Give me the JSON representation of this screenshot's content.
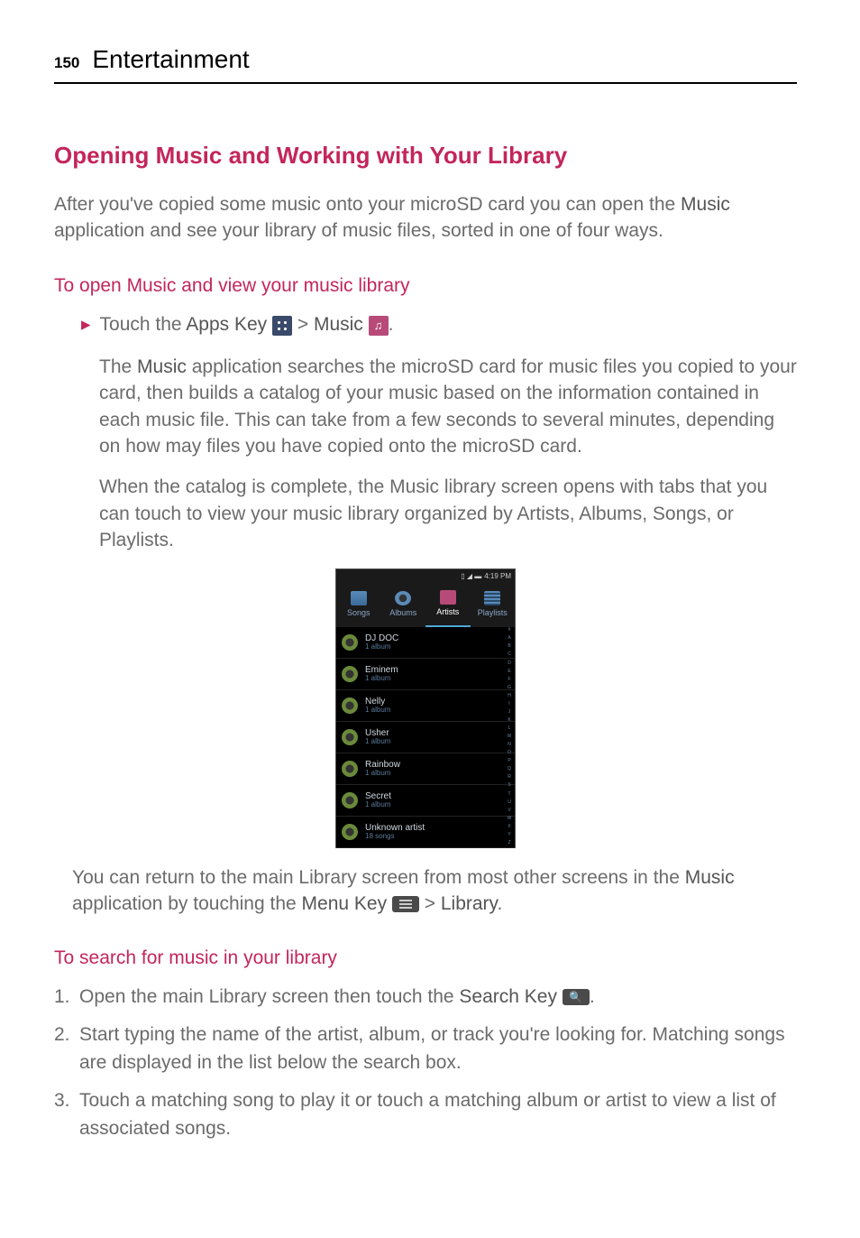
{
  "header": {
    "page_number": "150",
    "section": "Entertainment"
  },
  "h1": "Opening Music and Working with Your Library",
  "intro": {
    "part1": "After you've copied some music onto your microSD card you can open the ",
    "music_bold": "Music",
    "part2": " application and see your library of music files, sorted in one of four ways."
  },
  "sub1": "To open Music and view your music library",
  "step1": {
    "prefix": "Touch the ",
    "apps_key": "Apps Key",
    "sep": " > ",
    "music": "Music",
    "suffix": "."
  },
  "para1": "The Music application searches the microSD card for music files you copied to your card, then builds a catalog of your music based on the information contained in each music file. This can take from a few seconds to several minutes, depending on how may files you have copied onto the microSD card.",
  "para1_bold": "Music",
  "para2": "When the catalog is complete, the Music library screen opens with tabs that you can touch to view your music library organized by Artists, Albums, Songs, or Playlists.",
  "screenshot": {
    "status_time": "4:19 PM",
    "tabs": [
      {
        "label": "Songs"
      },
      {
        "label": "Albums"
      },
      {
        "label": "Artists"
      },
      {
        "label": "Playlists"
      }
    ],
    "rows": [
      {
        "title": "DJ DOC",
        "sub": "1 album"
      },
      {
        "title": "Eminem",
        "sub": "1 album"
      },
      {
        "title": "Nelly",
        "sub": "1 album"
      },
      {
        "title": "Usher",
        "sub": "1 album"
      },
      {
        "title": "Rainbow",
        "sub": "1 album"
      },
      {
        "title": "Secret",
        "sub": "1 album"
      },
      {
        "title": "Unknown artist",
        "sub": "18 songs"
      }
    ],
    "alpha": [
      "#",
      "A",
      "B",
      "C",
      "D",
      "E",
      "F",
      "G",
      "H",
      "I",
      "J",
      "K",
      "L",
      "M",
      "N",
      "O",
      "P",
      "Q",
      "R",
      "S",
      "T",
      "U",
      "V",
      "W",
      "X",
      "Y",
      "Z"
    ]
  },
  "after_img": {
    "part1": "You can return to the main Library screen from most other screens in the ",
    "music_bold": "Music",
    "part2": " application by touching the ",
    "menu_key": "Menu Key",
    "sep": " > ",
    "library": "Library",
    "suffix": "."
  },
  "sub2": "To search for music in your library",
  "ol": [
    {
      "num": "1.",
      "part1": "Open the main Library screen then touch the ",
      "search_key": "Search Key",
      "suffix": "."
    },
    {
      "num": "2.",
      "text": "Start typing the name of the artist, album, or track you're looking for. Matching songs are displayed in the list below the search box."
    },
    {
      "num": "3.",
      "text": "Touch a matching song to play it or touch a matching album or artist to view a list of associated songs."
    }
  ]
}
